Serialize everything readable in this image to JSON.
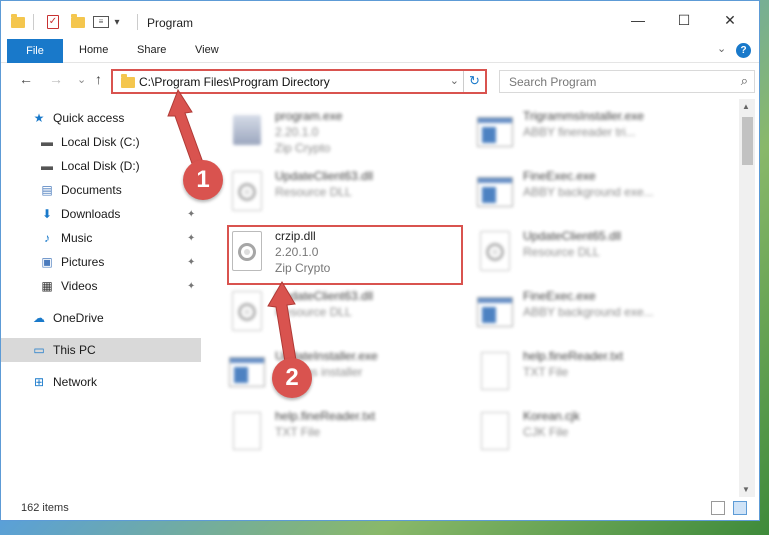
{
  "window": {
    "title": "Program",
    "controls": {
      "minimize": "—",
      "maximize": "☐",
      "close": "✕"
    }
  },
  "ribbon": {
    "file": "File",
    "tabs": [
      "Home",
      "Share",
      "View"
    ],
    "expand_glyph": "⌄",
    "help": "?"
  },
  "address": {
    "path": "C:\\Program Files\\Program Directory",
    "dropdown_glyph": "⌄",
    "refresh_glyph": "↻",
    "search_placeholder": "Search Program",
    "search_glyph": "⌕"
  },
  "nav_buttons": {
    "back": "←",
    "forward": "→",
    "recent": "⌄",
    "up": "↑"
  },
  "sidebar": {
    "items": [
      {
        "label": "Quick access",
        "icon": "star-icon"
      },
      {
        "label": "Local Disk (C:)",
        "icon": "drive-icon"
      },
      {
        "label": "Local Disk (D:)",
        "icon": "drive-icon"
      },
      {
        "label": "Documents",
        "icon": "documents-icon"
      },
      {
        "label": "Downloads",
        "icon": "download-icon"
      },
      {
        "label": "Music",
        "icon": "music-icon"
      },
      {
        "label": "Pictures",
        "icon": "pictures-icon"
      },
      {
        "label": "Videos",
        "icon": "videos-icon"
      },
      {
        "label": "OneDrive",
        "icon": "cloud-icon"
      },
      {
        "label": "This PC",
        "icon": "pc-icon"
      },
      {
        "label": "Network",
        "icon": "network-icon"
      }
    ],
    "pin_glyph": "📌"
  },
  "files": {
    "left": [
      {
        "name": "program.exe",
        "line2": "2.20.1.0",
        "line3": "Zip Crypto",
        "icon": "program-icon"
      },
      {
        "name": "UpdateClient63.dll",
        "line2": "Resource DLL",
        "line3": "",
        "icon": "dll-icon"
      },
      {
        "name": "crzip.dll",
        "line2": "2.20.1.0",
        "line3": "Zip Crypto",
        "icon": "dll-icon"
      },
      {
        "name": "UpdateClient63.dll",
        "line2": "Resource DLL",
        "line3": "",
        "icon": "dll-icon"
      },
      {
        "name": "UpdateInstaller.exe",
        "line2": "updates installer",
        "line3": "",
        "icon": "exe-icon"
      },
      {
        "name": "help.fineReader.txt",
        "line2": "TXT File",
        "line3": "",
        "icon": "txt-icon"
      }
    ],
    "right": [
      {
        "name": "TrigrammsInstaller.exe",
        "line2": "ABBY finereader tri...",
        "line3": "",
        "icon": "exe-icon"
      },
      {
        "name": "FineExec.exe",
        "line2": "ABBY background exe...",
        "line3": "",
        "icon": "exe-icon"
      },
      {
        "name": "UpdateClient65.dll",
        "line2": "Resource DLL",
        "line3": "",
        "icon": "dll-icon"
      },
      {
        "name": "FineExec.exe",
        "line2": "ABBY background exe...",
        "line3": "",
        "icon": "exe-icon"
      },
      {
        "name": "help.fineReader.txt",
        "line2": "TXT File",
        "line3": "",
        "icon": "txt-icon"
      },
      {
        "name": "Korean.cjk",
        "line2": "CJK File",
        "line3": "",
        "icon": "txt-icon"
      }
    ]
  },
  "status": {
    "count": "162 items"
  },
  "annotations": {
    "step1": "1",
    "step2": "2",
    "color": "#d9534f"
  },
  "colors": {
    "accent": "#1979ca",
    "highlight": "#d9534f",
    "selected": "#d9d9d9"
  }
}
